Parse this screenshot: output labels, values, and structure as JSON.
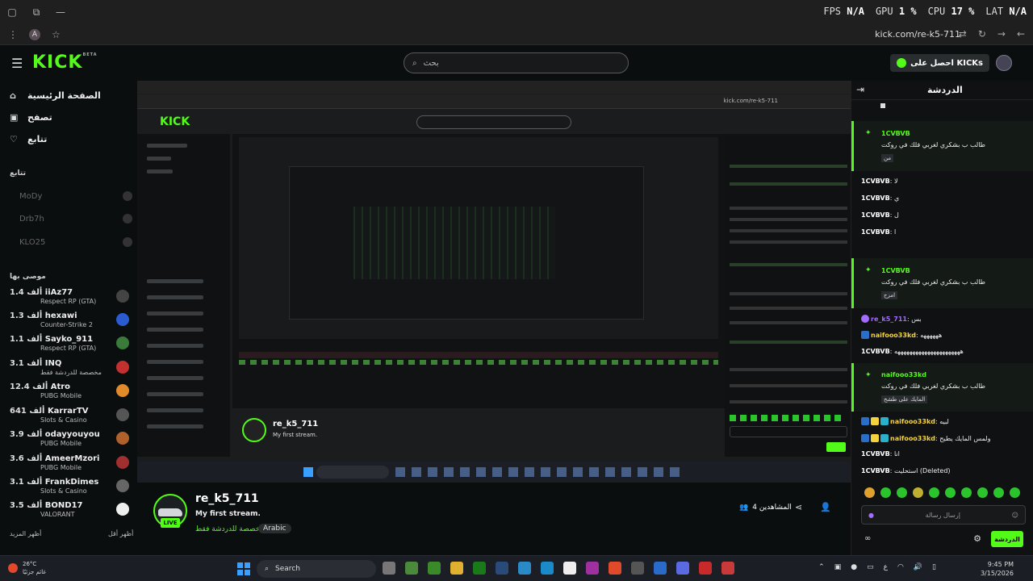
{
  "browser": {
    "url": "kick.com/re-k5-711",
    "profile_initial": "A",
    "overlay": [
      {
        "label": "FPS",
        "value": "N/A"
      },
      {
        "label": "GPU",
        "value": "1 %"
      },
      {
        "label": "CPU",
        "value": "17 %"
      },
      {
        "label": "LAT",
        "value": "N/A"
      }
    ]
  },
  "header": {
    "logo": "KICK",
    "logo_beta": "BETA",
    "search_placeholder": "بحث",
    "kicks_label": "احصل على KICKs"
  },
  "sidebar": {
    "nav": [
      {
        "label": "الصفحة الرئيسية",
        "icon": "home-icon"
      },
      {
        "label": "تصفح",
        "icon": "browse-icon"
      },
      {
        "label": "تتابع",
        "icon": "heart-icon"
      }
    ],
    "following_title": "تتابع",
    "following": [
      "MoDy",
      "Drb7h",
      "KLO25"
    ],
    "recommended_title": "موصى بها",
    "recommended": [
      {
        "viewers": "1.4 ألف",
        "name": "iiAz77",
        "category": "Respect RP (GTA)",
        "color": "#444"
      },
      {
        "viewers": "1.3 ألف",
        "name": "hexawi",
        "category": "Counter-Strike 2",
        "color": "#2a5bd0"
      },
      {
        "viewers": "1.1 ألف",
        "name": "Sayko_911",
        "category": "Respect RP (GTA)",
        "color": "#3a7a3a"
      },
      {
        "viewers": "3.1 ألف",
        "name": "INQ",
        "category": "مخصصة للدردشة فقط",
        "color": "#c23030"
      },
      {
        "viewers": "12.4 ألف",
        "name": "Atro",
        "category": "PUBG Mobile",
        "color": "#e08a2a"
      },
      {
        "viewers": "641 ألف",
        "name": "KarrarTV",
        "category": "Slots & Casino",
        "color": "#555"
      },
      {
        "viewers": "3.9 ألف",
        "name": "odayyouyou",
        "category": "PUBG Mobile",
        "color": "#b0602a"
      },
      {
        "viewers": "3.6 ألف",
        "name": "AmeerMzori",
        "category": "PUBG Mobile",
        "color": "#a03030"
      },
      {
        "viewers": "3.1 ألف",
        "name": "FrankDimes",
        "category": "Slots & Casino",
        "color": "#666"
      },
      {
        "viewers": "3.5 ألف",
        "name": "BOND17",
        "category": "VALORANT",
        "color": "#eee"
      }
    ],
    "show_more": "أظهر المزيد",
    "show_less": "أظهر أقل"
  },
  "stream": {
    "channel": "re_k5_711",
    "title": "My first stream.",
    "category": "مخصصة للدردشة فقط",
    "tag": "Arabic",
    "live": "LIVE",
    "viewers": "4 المشاهدين"
  },
  "chat": {
    "title": "الدردشة",
    "highlights": [
      {
        "user": "1CVBVB",
        "text": "طالب ب بشكري لغربي فلك في روكت",
        "pill": "من"
      },
      {
        "user": "1CVBVB",
        "text": "طالب ب بشكري لغربي فلك في روكت",
        "pill": "امزح"
      },
      {
        "user": "naifooo33kd",
        "text": "طالب ب بشكري لغربي فلك في روكت",
        "pill": "المايك على طشخ"
      }
    ],
    "messages": [
      {
        "user": "1CVBVB",
        "text": ": لا"
      },
      {
        "user": "1CVBVB",
        "text": ": ي"
      },
      {
        "user": "1CVBVB",
        "text": ": ل"
      },
      {
        "user": "1CVBVB",
        "text": ": ا"
      },
      {
        "user": "re_k5_711",
        "text": ": بس"
      },
      {
        "user": "naifooo33kd",
        "text": ": ههههههه"
      },
      {
        "user": "1CVBVB",
        "text": ": ههههههههههههههههههههههه"
      },
      {
        "user": "naifooo33kd",
        "text": ": لبيه"
      },
      {
        "user": "naifooo33kd",
        "text": ": ولمس المايك يطيح"
      },
      {
        "user": "1CVBVB",
        "text": ": انا"
      },
      {
        "user": "1CVBVB",
        "text": ": استحليت (Deleted)"
      }
    ],
    "input_placeholder": "إرسال رسالة",
    "send_label": "الدردشة"
  },
  "taskbar": {
    "temp": "26°C",
    "weather": "غائم جزئيًا",
    "search_label": "Search",
    "time": "9:45 PM",
    "date": "3/15/2026",
    "lang": "ع"
  }
}
